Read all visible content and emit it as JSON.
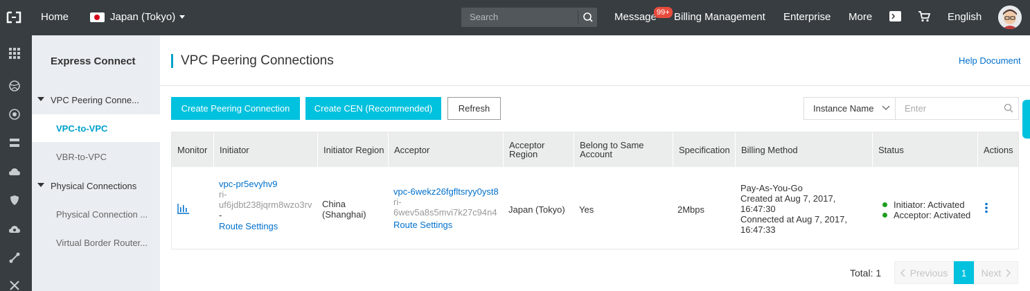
{
  "topbar": {
    "home": "Home",
    "region": "Japan (Tokyo)",
    "search_placeholder": "Search",
    "message": "Message",
    "message_badge": "99+",
    "billing": "Billing Management",
    "enterprise": "Enterprise",
    "more": "More",
    "language": "English"
  },
  "sidebar": {
    "title": "Express Connect",
    "groups": [
      {
        "label": "VPC Peering Conne..."
      },
      {
        "label": "Physical Connections"
      }
    ],
    "items": [
      {
        "label": "VPC-to-VPC"
      },
      {
        "label": "VBR-to-VPC"
      },
      {
        "label": "Physical Connection ..."
      },
      {
        "label": "Virtual Border Router..."
      }
    ]
  },
  "main": {
    "title": "VPC Peering Connections",
    "help": "Help Document",
    "buttons": {
      "create_peering": "Create Peering Connection",
      "create_cen": "Create CEN (Recommended)",
      "refresh": "Refresh"
    },
    "filter": {
      "select_label": "Instance Name",
      "input_placeholder": "Enter"
    },
    "table": {
      "headers": [
        "Monitor",
        "Initiator",
        "Initiator Region",
        "Acceptor",
        "Acceptor Region",
        "Belong to Same Account",
        "Specification",
        "Billing Method",
        "Status",
        "Actions"
      ],
      "row": {
        "initiator_id": "vpc-pr5evyhv9",
        "initiator_ri_1": "ri-",
        "initiator_ri_2": "uf6jdbt238jqrm8wzo3rv",
        "initiator_dash": "-",
        "initiator_route": "Route Settings",
        "initiator_region_1": "China",
        "initiator_region_2": "(Shanghai)",
        "acceptor_id": "vpc-6wekz26fgfltsryy0yst8",
        "acceptor_ri_1": "ri-",
        "acceptor_ri_2": "6wev5a8s5mvi7k27c94n4",
        "acceptor_route": "Route Settings",
        "acceptor_region": "Japan (Tokyo)",
        "same_account": "Yes",
        "spec": "2Mbps",
        "billing_1": "Pay-As-You-Go",
        "billing_2": "Created at Aug 7, 2017,",
        "billing_3": "16:47:30",
        "billing_4": "Connected at Aug 7, 2017,",
        "billing_5": "16:47:33",
        "status_initiator": "Initiator: Activated",
        "status_acceptor": "Acceptor: Activated"
      }
    },
    "pagination": {
      "total": "Total: 1",
      "previous": "Previous",
      "page": "1",
      "next": "Next"
    }
  },
  "colors": {
    "topbar": "#373d41",
    "accent": "#00c1de",
    "link": "#0070cc",
    "status_ok": "#1e9e1e",
    "badge": "#e84b3c"
  }
}
